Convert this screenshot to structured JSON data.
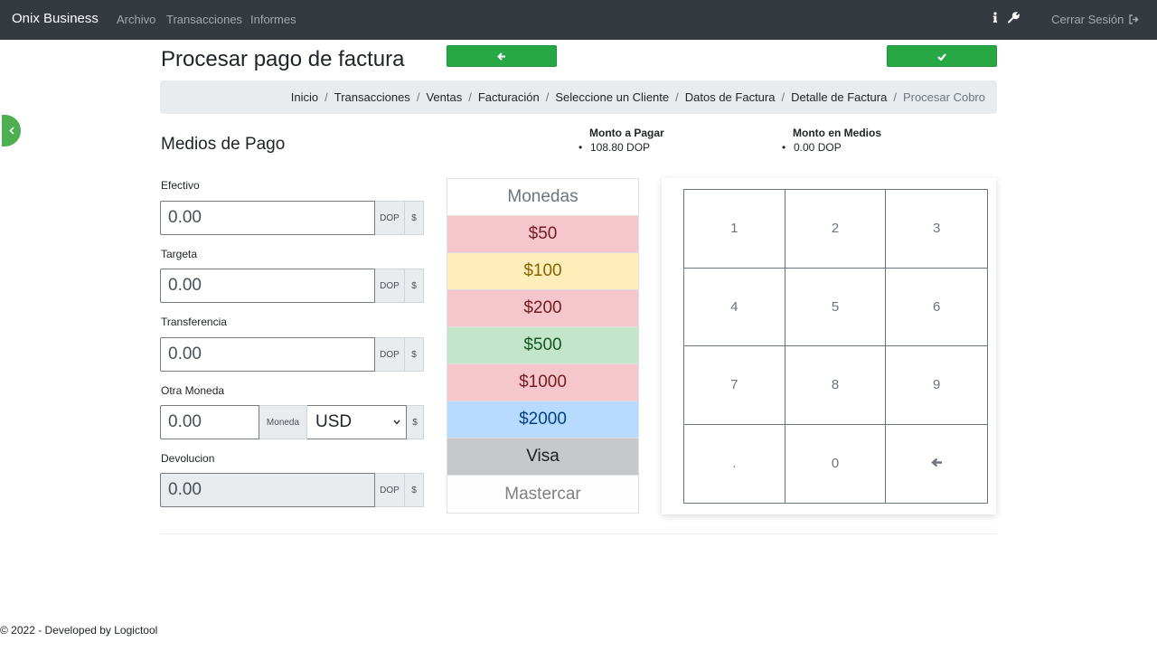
{
  "navbar": {
    "brand": "Onix Business",
    "links": [
      "Archivo",
      "Transacciones",
      "Informes"
    ],
    "info_icon": "info-icon",
    "settings_icon": "wrench-icon",
    "logout_label": "Cerrar Sesión",
    "logout_icon": "sign-out-icon"
  },
  "page": {
    "title": "Procesar pago de factura",
    "back_button_icon": "arrow-left-icon",
    "confirm_button_icon": "check-icon"
  },
  "breadcrumb": [
    "Inicio",
    "Transacciones",
    "Ventas",
    "Facturación",
    "Seleccione un Cliente",
    "Datos de Factura",
    "Detalle de Factura",
    "Procesar Cobro"
  ],
  "section_title": "Medios de Pago",
  "summary": {
    "to_pay_label": "Monto a Pagar",
    "to_pay_value": "108.80 DOP",
    "in_media_label": "Monto en Medios",
    "in_media_value": "0.00 DOP"
  },
  "fields": {
    "efectivo": {
      "label": "Efectivo",
      "value": "0.00",
      "currency": "DOP",
      "symbol": "$"
    },
    "targeta": {
      "label": "Targeta",
      "value": "0.00",
      "currency": "DOP",
      "symbol": "$"
    },
    "transferencia": {
      "label": "Transferencia",
      "value": "0.00",
      "currency": "DOP",
      "symbol": "$"
    },
    "otra_moneda": {
      "label": "Otra Moneda",
      "value": "0.00",
      "addon": "Moneda",
      "selected": "USD",
      "symbol": "$"
    },
    "devolucion": {
      "label": "Devolucion",
      "value": "0.00",
      "currency": "DOP",
      "symbol": "$"
    }
  },
  "denominations": {
    "header": "Monedas",
    "items": [
      {
        "label": "$50",
        "bg": "#f5c6cb",
        "color": "#721c24"
      },
      {
        "label": "$100",
        "bg": "#ffeeba",
        "color": "#856404"
      },
      {
        "label": "$200",
        "bg": "#f5c6cb",
        "color": "#721c24"
      },
      {
        "label": "$500",
        "bg": "#c3e6cb",
        "color": "#155724"
      },
      {
        "label": "$1000",
        "bg": "#f5c6cb",
        "color": "#721c24"
      },
      {
        "label": "$2000",
        "bg": "#b8daff",
        "color": "#004085"
      },
      {
        "label": "Visa",
        "bg": "#c6c8ca",
        "color": "#1b1e21"
      },
      {
        "label": "Mastercar",
        "bg": "#fdfdfe",
        "color": "#818182"
      }
    ]
  },
  "keypad": [
    "1",
    "2",
    "3",
    "4",
    "5",
    "6",
    "7",
    "8",
    "9",
    ".",
    "0",
    "←"
  ],
  "footer": "© 2022 - Developed by Logictool"
}
